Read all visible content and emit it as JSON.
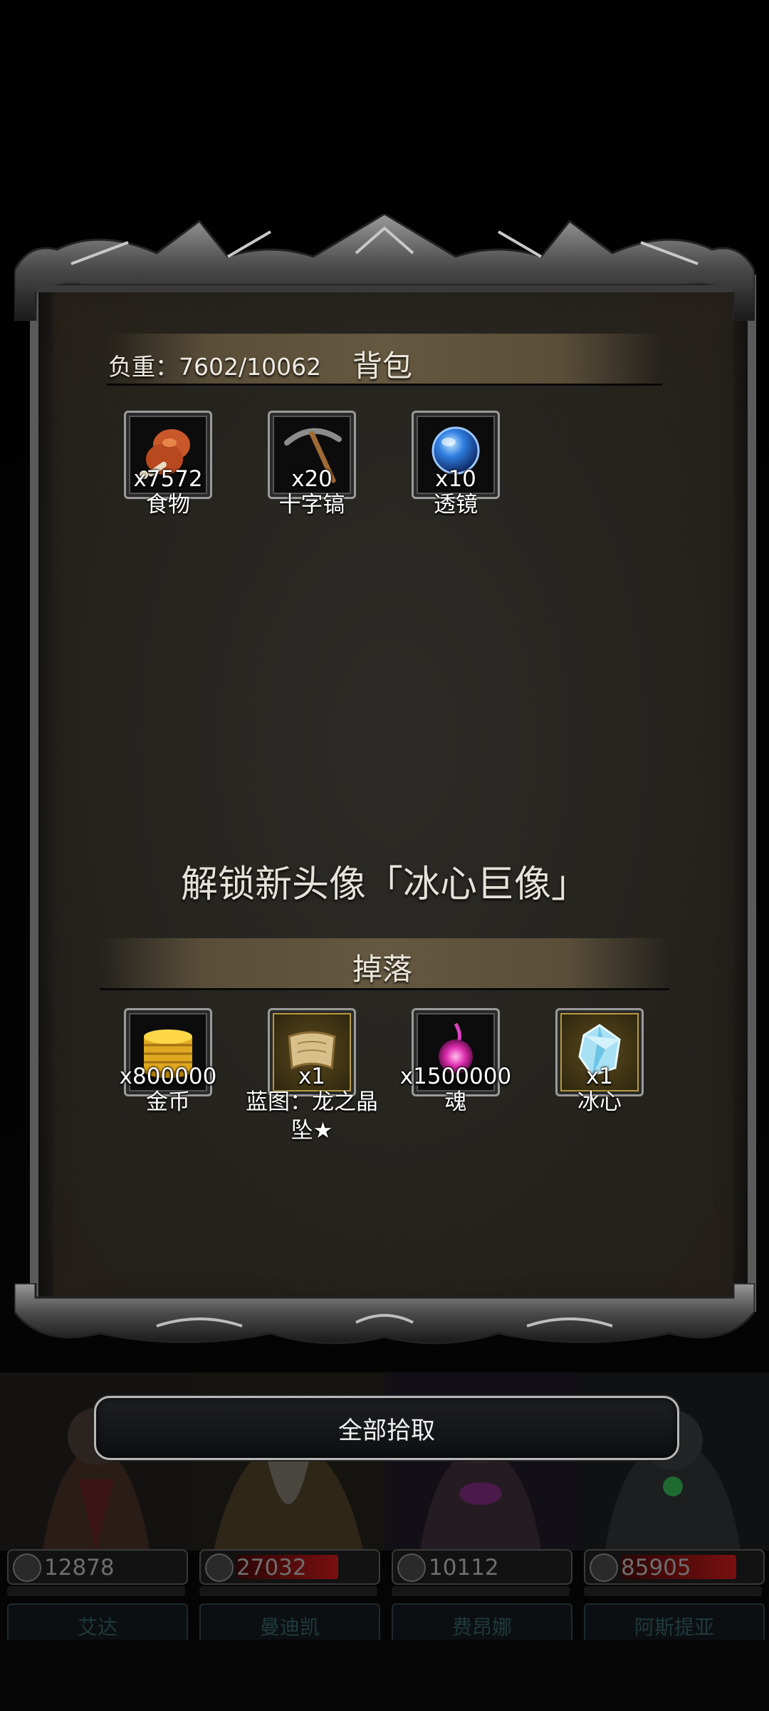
{
  "backpack": {
    "title": "背包",
    "weight_label": "负重：7602/10062",
    "items": [
      {
        "name": "食物",
        "count": "x7572",
        "icon": "drumstick-icon"
      },
      {
        "name": "十字镐",
        "count": "x20",
        "icon": "pickaxe-icon"
      },
      {
        "name": "透镜",
        "count": "x10",
        "icon": "lens-orb-icon"
      }
    ]
  },
  "unlock_message": "解锁新头像「冰心巨像」",
  "drops": {
    "title": "掉落",
    "items": [
      {
        "name": "金币",
        "count": "x800000",
        "icon": "gold-coins-icon"
      },
      {
        "name": "蓝图：龙之晶坠★",
        "count": "x1",
        "icon": "blueprint-scroll-icon"
      },
      {
        "name": "魂",
        "count": "x1500000",
        "icon": "soul-orb-icon"
      },
      {
        "name": "冰心",
        "count": "x1",
        "icon": "ice-crystal-icon"
      }
    ]
  },
  "pickup_button": {
    "label": "全部拾取"
  },
  "heroes": [
    {
      "name": "艾达",
      "hp": "12878",
      "hp_fill": 0.0
    },
    {
      "name": "曼迪凯",
      "hp": "27032",
      "hp_fill": 0.75
    },
    {
      "name": "费昂娜",
      "hp": "10112",
      "hp_fill": 0.0
    },
    {
      "name": "阿斯提亚",
      "hp": "85905",
      "hp_fill": 0.85
    }
  ],
  "colors": {
    "panel": "#26241f",
    "section_bar": "#645840",
    "frame_metal": "#5a5a5a",
    "slot_gold": "#b49a3e"
  }
}
